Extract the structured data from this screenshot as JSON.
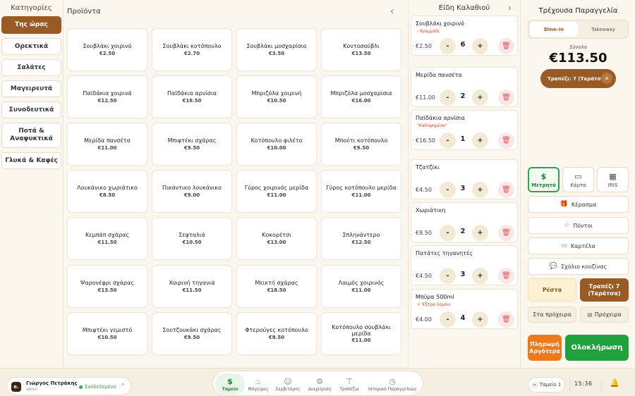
{
  "categories": {
    "title": "Κατηγορίες",
    "items": [
      "Της ώρας",
      "Ορεκτικά",
      "Σαλάτες",
      "Μαγειρευτά",
      "Συνοδευτικά",
      "Ποτά & Αναψυκτικά",
      "Γλυκά & Καφές"
    ],
    "active": "Της ώρας"
  },
  "products": {
    "title": "Προϊόντα",
    "nav_icon": "chevron-left",
    "items": [
      {
        "name": "Σουβλάκι χοιρινό",
        "price": "€2.50"
      },
      {
        "name": "Σουβλάκι κοτόπουλο",
        "price": "€2.70"
      },
      {
        "name": "Σουβλάκι μοσχαρίσιο",
        "price": "€3.50"
      },
      {
        "name": "Κοντοσούβλι",
        "price": "€13.50"
      },
      {
        "name": "Παϊδάκια χοιρινά",
        "price": "€12.50"
      },
      {
        "name": "Παϊδάκια αρνίσια",
        "price": "€16.50"
      },
      {
        "name": "Μπριζόλα χοιρινή",
        "price": "€10.50"
      },
      {
        "name": "Μπριζόλα μοσχαρίσια",
        "price": "€16.00"
      },
      {
        "name": "Μερίδα πανσέτα",
        "price": "€11.00"
      },
      {
        "name": "Μπιφτέκι σχάρας",
        "price": "€9.50"
      },
      {
        "name": "Κοτόπουλο φιλέτο",
        "price": "€10.00"
      },
      {
        "name": "Μπούτι κοτόπουλο",
        "price": "€9.50"
      },
      {
        "name": "Λουκάνικο χωριάτικο",
        "price": "€8.50"
      },
      {
        "name": "Πικάντικο λουκάνικο",
        "price": "€9.00"
      },
      {
        "name": "Γύρος χοιρινός μερίδα",
        "price": "€11.00"
      },
      {
        "name": "Γύρος κοτόπουλο μερίδα",
        "price": "€11.00"
      },
      {
        "name": "Κεμπάπ σχάρας",
        "price": "€11.50"
      },
      {
        "name": "Σεφταλιά",
        "price": "€10.50"
      },
      {
        "name": "Κοκορέτσι",
        "price": "€13.00"
      },
      {
        "name": "Σπληνάντερο",
        "price": "€12.50"
      },
      {
        "name": "Ψαρονέφρι σχάρας",
        "price": "€13.50"
      },
      {
        "name": "Χοιρινή τηγανιά",
        "price": "€11.50"
      },
      {
        "name": "Μεικτή σχάρας",
        "price": "€18.50"
      },
      {
        "name": "Λαιμός χοιρινός",
        "price": "€11.00"
      },
      {
        "name": "Μπιφτέκι γεμιστό",
        "price": "€10.50"
      },
      {
        "name": "Σουτζουκάκι σχάρας",
        "price": "€9.50"
      },
      {
        "name": "Φτερούγες κοτόπουλο",
        "price": "€8.50"
      },
      {
        "name": "Κοτόπουλο σουβλάκι μερίδα",
        "price": "€11.00"
      }
    ]
  },
  "cart": {
    "title": "Είδη Καλαθιού",
    "nav_icon": "chevron-right",
    "minus_label": "-",
    "plus_label": "+",
    "items": [
      {
        "name": "Σουβλάκι χοιρινό",
        "note": "- Κρεμμύδι",
        "price": "€2.50",
        "qty": "6"
      },
      {
        "name": "Μερίδα πανσέτα",
        "note": "",
        "price": "€11.00",
        "qty": "2"
      },
      {
        "name": "Παϊδάκια αρνίσια",
        "note": "\"Καλοψημένα\"",
        "price": "€16.50",
        "qty": "1"
      },
      {
        "name": "Τζατζίκι",
        "note": "",
        "price": "€4.50",
        "qty": "3"
      },
      {
        "name": "Χωριάτικη",
        "note": "",
        "price": "€8.50",
        "qty": "2"
      },
      {
        "name": "Πατάτες τηγανητές",
        "note": "",
        "price": "€4.50",
        "qty": "3"
      },
      {
        "name": "Μπύρα 500ml",
        "note": "+ Έξτρα λεμόνι",
        "price": "€4.00",
        "qty": "4"
      }
    ]
  },
  "order": {
    "title": "Τρέχουσα Παραγγελία",
    "tabs": [
      "Dine-in",
      "Takeaway"
    ],
    "active_tab": "Dine-in",
    "total_label": "Σύνολο",
    "total": "€113.50",
    "table_pill": "Τραπέζι: 7 (Ταράτσα)",
    "payments": [
      {
        "label": "Μετρητά",
        "icon": "dollar-icon"
      },
      {
        "label": "Κάρτα",
        "icon": "card-icon"
      },
      {
        "label": "IRIS",
        "icon": "qr-icon"
      }
    ],
    "active_payment": "Μετρητά",
    "actions": [
      {
        "label": "Κέρασμα",
        "icon": "gift-icon"
      },
      {
        "label": "Πόντοι",
        "icon": "star-icon"
      },
      {
        "label": "Καρτέλα",
        "icon": "card-icon"
      },
      {
        "label": "Σχόλιο κουζίνας",
        "icon": "comment-icon"
      }
    ],
    "resta": "Ρέστα",
    "table_button": "Τραπέζι 7 (Ταράτσα)",
    "drafts": "Στα πρόχειρα",
    "draft": "Πρόχειρα",
    "pay_later": "Πληρωμή Αργότερα",
    "complete": "Ολοκλήρωση"
  },
  "bottom": {
    "user_initial": "e.",
    "user_name": "Γιώργος Πετράκης",
    "user_role": "admin",
    "status": "Συνδεδεμένο",
    "nav": [
      "Ταμείο",
      "Μάγειρας",
      "Σερβιτόρος",
      "Διαχείριση",
      "Τραπέζια",
      "Ιστορικό Παραγγελιών"
    ],
    "active_nav": "Ταμείο",
    "store": "Ταμείο 1",
    "clock": "15:36"
  },
  "colors": {
    "accent": "#9a5a24",
    "success": "#1fa23d",
    "warning": "#f07a1a",
    "background": "#fbf7ef"
  }
}
